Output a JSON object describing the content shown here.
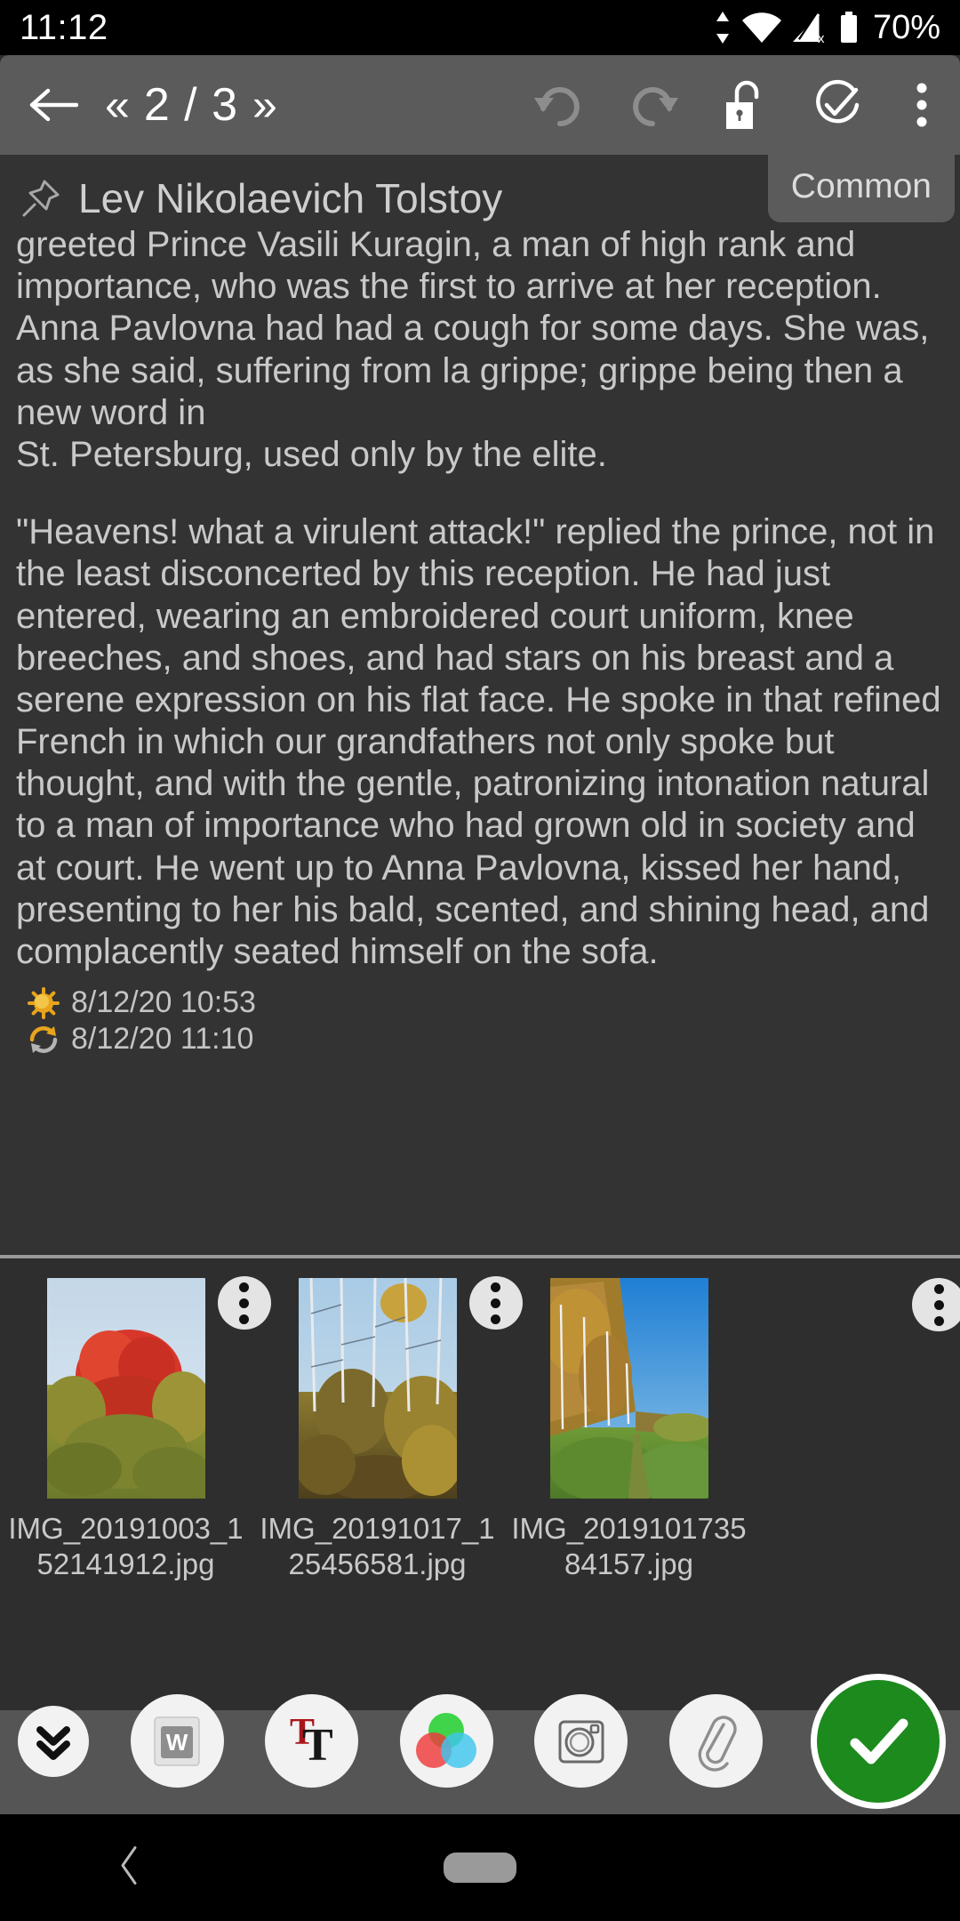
{
  "status_bar": {
    "time": "11:12",
    "battery_percent": "70%",
    "icons": [
      "data-transfer-icon",
      "wifi-icon",
      "cellular-no-sim-icon",
      "battery-icon"
    ]
  },
  "toolbar": {
    "back_label": "back-arrow",
    "prev_label": "«",
    "page_indicator": "2 / 3",
    "next_label": "»",
    "undo_label": "undo",
    "redo_label": "redo",
    "lock_label": "unlocked",
    "check_label": "check-circle",
    "menu_label": "overflow-menu"
  },
  "tab": {
    "common_label": "Common"
  },
  "note": {
    "title": "Lev Nikolaevich Tolstoy",
    "paragraph1": "greeted Prince Vasili Kuragin, a man of high rank and importance, who was the first to arrive at her reception. Anna Pavlovna had had a cough for some days. She was, as she said, suffering from la grippe; grippe being then a new word in",
    "paragraph2": "St. Petersburg, used only by the elite.",
    "paragraph3": "\"Heavens! what a virulent attack!\" replied the prince, not in the least disconcerted by this reception. He had just entered, wearing an embroidered court uniform, knee breeches, and shoes, and had stars on his breast and a serene expression on his flat face. He spoke in that refined French in which our grandfathers not only spoke but thought, and with the gentle, patronizing intonation natural to a man of importance who had grown old in society and at court. He went up to Anna Pavlovna, kissed her hand, presenting to her his bald, scented, and shining head, and complacently seated himself on the sofa.",
    "created_time": "8/12/20 10:53",
    "modified_time": "8/12/20 11:10"
  },
  "attachments": [
    {
      "filename": "IMG_20191003_152141912.jpg"
    },
    {
      "filename": "IMG_20191017_125456581.jpg"
    },
    {
      "filename": "IMG_201910173584157.jpg"
    }
  ],
  "bottom_bar": {
    "items": [
      {
        "name": "collapse-icon"
      },
      {
        "name": "word-document-icon"
      },
      {
        "name": "font-format-icon"
      },
      {
        "name": "color-picker-icon"
      },
      {
        "name": "camera-icon"
      },
      {
        "name": "attach-paperclip-icon"
      },
      {
        "name": "done-check-button"
      }
    ]
  },
  "nav_bar": {
    "back_label": "nav-back",
    "home_label": "nav-home-pill"
  },
  "colors": {
    "status_bar_bg": "#000000",
    "toolbar_bg": "#5b5b5b",
    "note_bg": "#333333",
    "page_bg": "#2e2e2e",
    "text": "#c9c9c9",
    "accent_green": "#1c8a1c",
    "timestamp_gold": "#e8a41c"
  }
}
